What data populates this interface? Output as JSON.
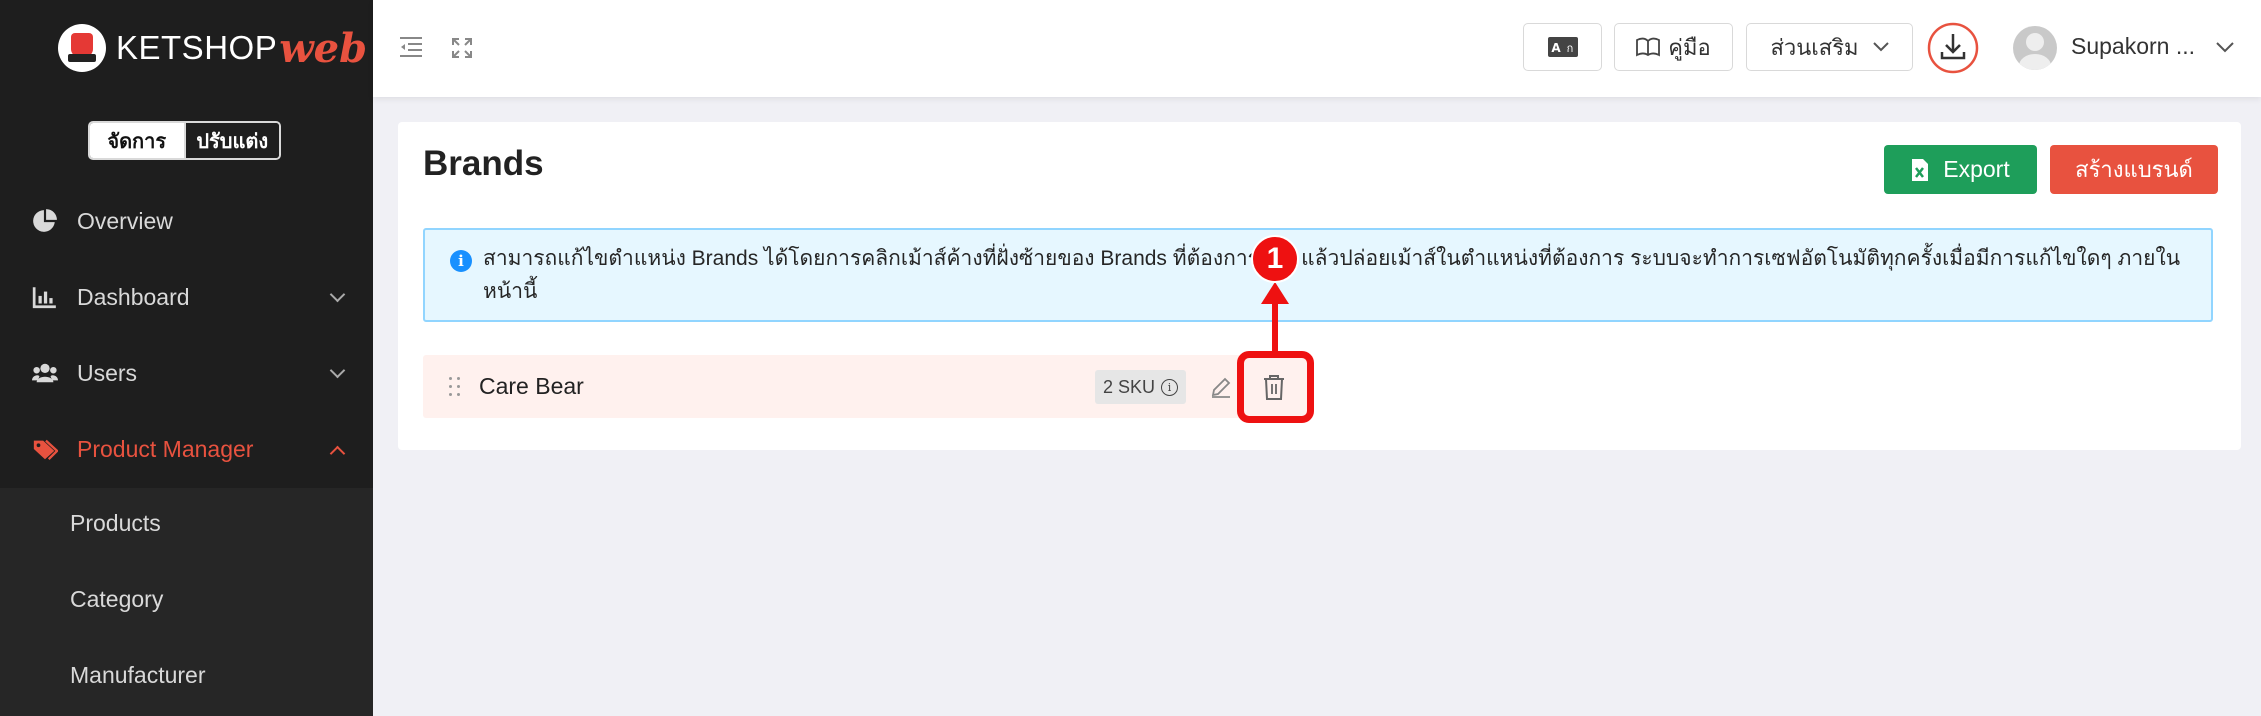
{
  "app": {
    "logo_main": "KETSHOP",
    "logo_web": "web"
  },
  "mode_toggle": {
    "manage": "จัดการ",
    "customize": "ปรับแต่ง"
  },
  "sidebar": {
    "items": [
      {
        "label": "Overview",
        "icon": "pie-chart-icon"
      },
      {
        "label": "Dashboard",
        "icon": "bar-chart-icon"
      },
      {
        "label": "Users",
        "icon": "users-icon"
      },
      {
        "label": "Product Manager",
        "icon": "tag-icon",
        "active": true
      }
    ],
    "submenu": [
      "Products",
      "Category",
      "Manufacturer"
    ]
  },
  "header": {
    "manual_label": "คู่มือ",
    "addons_label": "ส่วนเสริม",
    "user_name": "Supakorn ..."
  },
  "main": {
    "title": "Brands",
    "export_label": "Export",
    "create_label": "สร้างแบรนด์",
    "info_text": "สามารถแก้ไขตำแหน่ง Brands ได้โดยการคลิกเม้าส์ค้างที่ฝั่งซ้ายของ Brands ที่ต้องการย้าย แล้วปล่อยเม้าส์ในตำแหน่งที่ต้องการ ระบบจะทำการเซฟอัตโนมัติทุกครั้งเมื่อมีการแก้ไขใดๆ ภายในหน้านี้",
    "brands": [
      {
        "name": "Care Bear",
        "sku": "2 SKU"
      }
    ]
  },
  "annotation": {
    "step": "1"
  },
  "colors": {
    "accent": "#e8523f",
    "export_green": "#1e9e5a",
    "sidebar_bg": "#1e1e1e",
    "info_bg": "#e6f7ff",
    "annotation_red": "#e11"
  }
}
